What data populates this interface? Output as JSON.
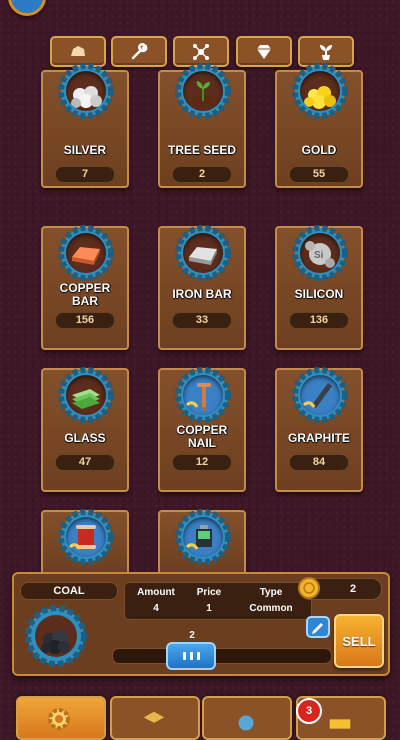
{
  "tabs": [
    {
      "name": "stone-icon"
    },
    {
      "name": "wrench-icon"
    },
    {
      "name": "molecule-icon"
    },
    {
      "name": "gem-icon"
    },
    {
      "name": "sprout-icon"
    }
  ],
  "items": [
    {
      "label": "SILVER",
      "count": "7",
      "icon": "silver-ore-icon"
    },
    {
      "label": "TREE SEED",
      "count": "2",
      "icon": "tree-seed-icon"
    },
    {
      "label": "GOLD",
      "count": "55",
      "icon": "gold-ore-icon"
    },
    {
      "label": "COPPER",
      "label2": "BAR",
      "count": "156",
      "icon": "copper-bar-icon"
    },
    {
      "label": "IRON BAR",
      "count": "33",
      "icon": "iron-bar-icon"
    },
    {
      "label": "SILICON",
      "count": "136",
      "icon": "silicon-icon"
    },
    {
      "label": "GLASS",
      "count": "47",
      "icon": "glass-icon"
    },
    {
      "label": "COPPER",
      "label2": "NAIL",
      "count": "12",
      "icon": "copper-nail-icon"
    },
    {
      "label": "GRAPHITE",
      "count": "84",
      "icon": "graphite-icon"
    },
    {
      "icon": "copper-wire-icon"
    },
    {
      "icon": "battery-icon"
    }
  ],
  "detail": {
    "name": "COAL",
    "amount_label": "Amount",
    "amount_value": "4",
    "price_label": "Price",
    "price_value": "1",
    "type_label": "Type",
    "type_value": "Common",
    "coins": "2",
    "slider_value": "2",
    "slider_fraction": 0.5,
    "sell_label": "SELL"
  },
  "nav": {
    "notification_count": "3"
  },
  "colors": {
    "background": "#3d1726",
    "panel": "#6a3e1e",
    "border": "#c8893c",
    "accent_blue": "#2f86d6",
    "accent_orange": "#f6b230"
  }
}
